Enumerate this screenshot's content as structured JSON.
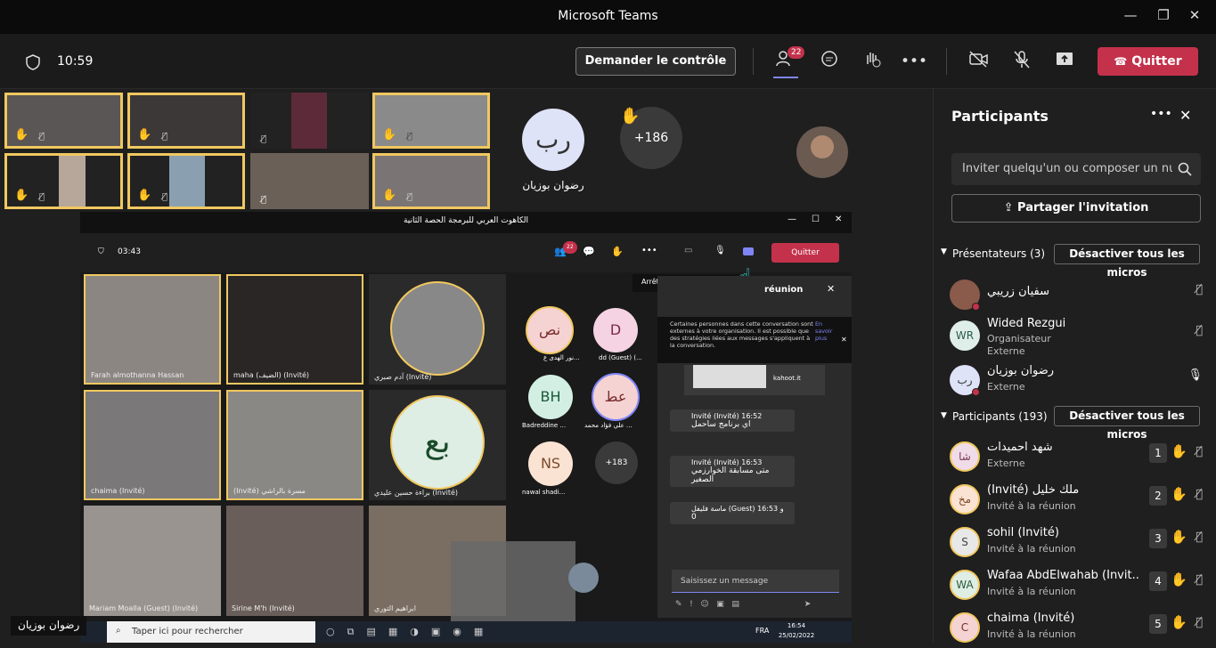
{
  "window": {
    "title": "Microsoft Teams",
    "min": "—",
    "max": "❐",
    "close": "✕"
  },
  "toolbar": {
    "time": "10:59",
    "request_control": "Demander le contrôle",
    "participants_badge": "22",
    "more": "•••",
    "quit": "Quitter"
  },
  "stage": {
    "avatar_initials": "رب",
    "avatar_name": "رضوان بوزيان",
    "overflow_count": "+186",
    "bottom_name": "رضوان بوزيان"
  },
  "shared_screen": {
    "title": "الكاهوت العربي للبرمجة الحصة الثانية",
    "time": "03:43",
    "badge": "22",
    "quit": "Quitter",
    "tooltip": "Arrêter le partage (Ctrl+...",
    "chat_header": "réunion",
    "tiles": [
      {
        "label": "Farah almothanna Hassan"
      },
      {
        "label": "maha (الضيف) (Invité)"
      },
      {
        "label": "آدم صبري (Invité)"
      },
      {
        "label": "chaima (Invité)"
      },
      {
        "label": "(Invité) مسرة بالراشي"
      },
      {
        "label": "براءة حسين عليدي (Invité)"
      },
      {
        "label": "Mariam Moalla (Guest) (Invité)"
      },
      {
        "label": "Sirine M'h (Invité)"
      },
      {
        "label": "ابراهيم التوري"
      }
    ],
    "avatars": [
      {
        "initials": "نص",
        "name": "نور الهدى ع..."
      },
      {
        "initials": "D",
        "name": "dd (Guest) (..."
      },
      {
        "initials": "BH",
        "name": "Badreddine ..."
      },
      {
        "initials": "عط",
        "name": "علي فؤاد محمد ..."
      },
      {
        "initials": "NS",
        "name": "nawal shadi..."
      },
      {
        "initials": "+183",
        "name": ""
      },
      {
        "initials": "بع",
        "name": ""
      }
    ],
    "notice": "Certaines personnes dans cette conversation sont externes à votre organisation. Il est possible que des stratégies liées aux messages s'appliquent à la conversation.",
    "notice_link": "En savoir plus",
    "kahoot": "kahoot.it",
    "messages": [
      {
        "author": "Invité (Invité)",
        "time": "16:52",
        "text": "اي برنامج ساحمل"
      },
      {
        "author": "Invité (Invité)",
        "time": "16:53",
        "text": "متى مسابقة الخوارزمي الصغير"
      },
      {
        "author": "ماسة فليفل (Guest) و",
        "time": "16:53",
        "text": "0"
      }
    ],
    "compose_placeholder": "Saisissez un message",
    "taskbar_search": "Taper ici pour rechercher",
    "taskbar_lang": "FRA",
    "taskbar_time": "16:54",
    "taskbar_date": "25/02/2022"
  },
  "panel": {
    "title": "Participants",
    "invite_placeholder": "Inviter quelqu'un ou composer un numéro",
    "share_invite": "Partager l'invitation",
    "presenters_header": "Présentateurs (3)",
    "mute_all": "Désactiver tous les micros",
    "participants_header": "Participants (193)",
    "presenters": [
      {
        "initials": "",
        "name": "سفيان زريبي",
        "sub": "",
        "sub2": ""
      },
      {
        "initials": "WR",
        "name": "Wided Rezgui",
        "sub": "Organisateur",
        "sub2": "Externe"
      },
      {
        "initials": "رب",
        "name": "رضوان بوزيان",
        "sub": "Externe",
        "sub2": ""
      }
    ],
    "participants": [
      {
        "initials": "شا",
        "name": "شهد احميدات",
        "sub": "Externe",
        "rank": "1"
      },
      {
        "initials": "مخ",
        "name": "(Invité) ملك خليل",
        "sub": "Invité à la réunion",
        "rank": "2"
      },
      {
        "initials": "S",
        "name": "sohil (Invité)",
        "sub": "Invité à la réunion",
        "rank": "3"
      },
      {
        "initials": "WA",
        "name": "Wafaa AbdElwahab (Invit...",
        "sub": "Invité à la réunion",
        "rank": "4"
      },
      {
        "initials": "C",
        "name": "chaima (Invité)",
        "sub": "Invité à la réunion",
        "rank": "5"
      }
    ]
  },
  "colors": {
    "accent": "#c4314b",
    "raise": "#f0c860",
    "avatar_bg": "#dfe3f7"
  }
}
